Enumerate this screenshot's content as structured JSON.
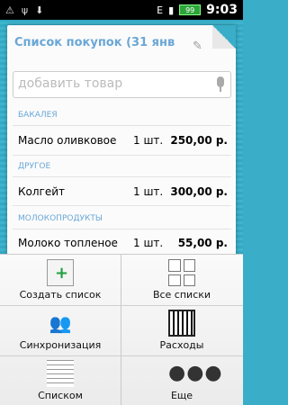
{
  "status_bar": {
    "time": "9:03",
    "battery": "99"
  },
  "list": {
    "title": "Список покупок (31 янв",
    "search_placeholder": "добавить товар",
    "sections": [
      {
        "name": "БАКАЛЕЯ",
        "items": [
          {
            "name": "Масло оливковое",
            "qty": "1 шт.",
            "price": "250,00 р."
          }
        ]
      },
      {
        "name": "ДРУГОЕ",
        "items": [
          {
            "name": "Колгейт",
            "qty": "1 шт.",
            "price": "300,00 р."
          }
        ]
      },
      {
        "name": "МОЛОКОПРОДУКТЫ",
        "items": [
          {
            "name": "Молоко топленое",
            "qty": "1 шт.",
            "price": "55,00 р."
          }
        ]
      }
    ]
  },
  "menu": {
    "create_list": "Создать список",
    "all_lists": "Все списки",
    "sync": "Синхронизация",
    "expenses": "Расходы",
    "as_list": "Списком",
    "more": "Еще"
  }
}
